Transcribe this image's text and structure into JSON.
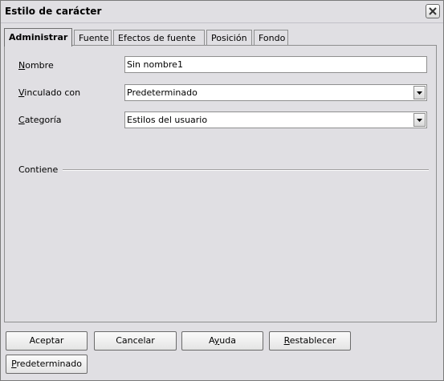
{
  "window": {
    "title": "Estilo de carácter"
  },
  "tabs": [
    {
      "label": "Administrar",
      "active": true
    },
    {
      "label": "Fuente",
      "active": false
    },
    {
      "label": "Efectos de fuente",
      "active": false
    },
    {
      "label": "Posición",
      "active": false
    },
    {
      "label": "Fondo",
      "active": false
    }
  ],
  "form": {
    "name": {
      "label_first": "N",
      "label_rest": "ombre",
      "value": "Sin nombre1"
    },
    "linked": {
      "label_first": "V",
      "label_rest": "inculado con",
      "value": "Predeterminado"
    },
    "category": {
      "label_first": "C",
      "label_rest": "ategoría",
      "value": "Estilos del usuario"
    }
  },
  "contains": {
    "label": "Contiene"
  },
  "buttons": {
    "ok": "Aceptar",
    "cancel": "Cancelar",
    "help_pre": "A",
    "help_ul": "y",
    "help_post": "uda",
    "reset_ul": "R",
    "reset_rest": "establecer",
    "default_ul": "P",
    "default_rest": "redeterminado"
  }
}
